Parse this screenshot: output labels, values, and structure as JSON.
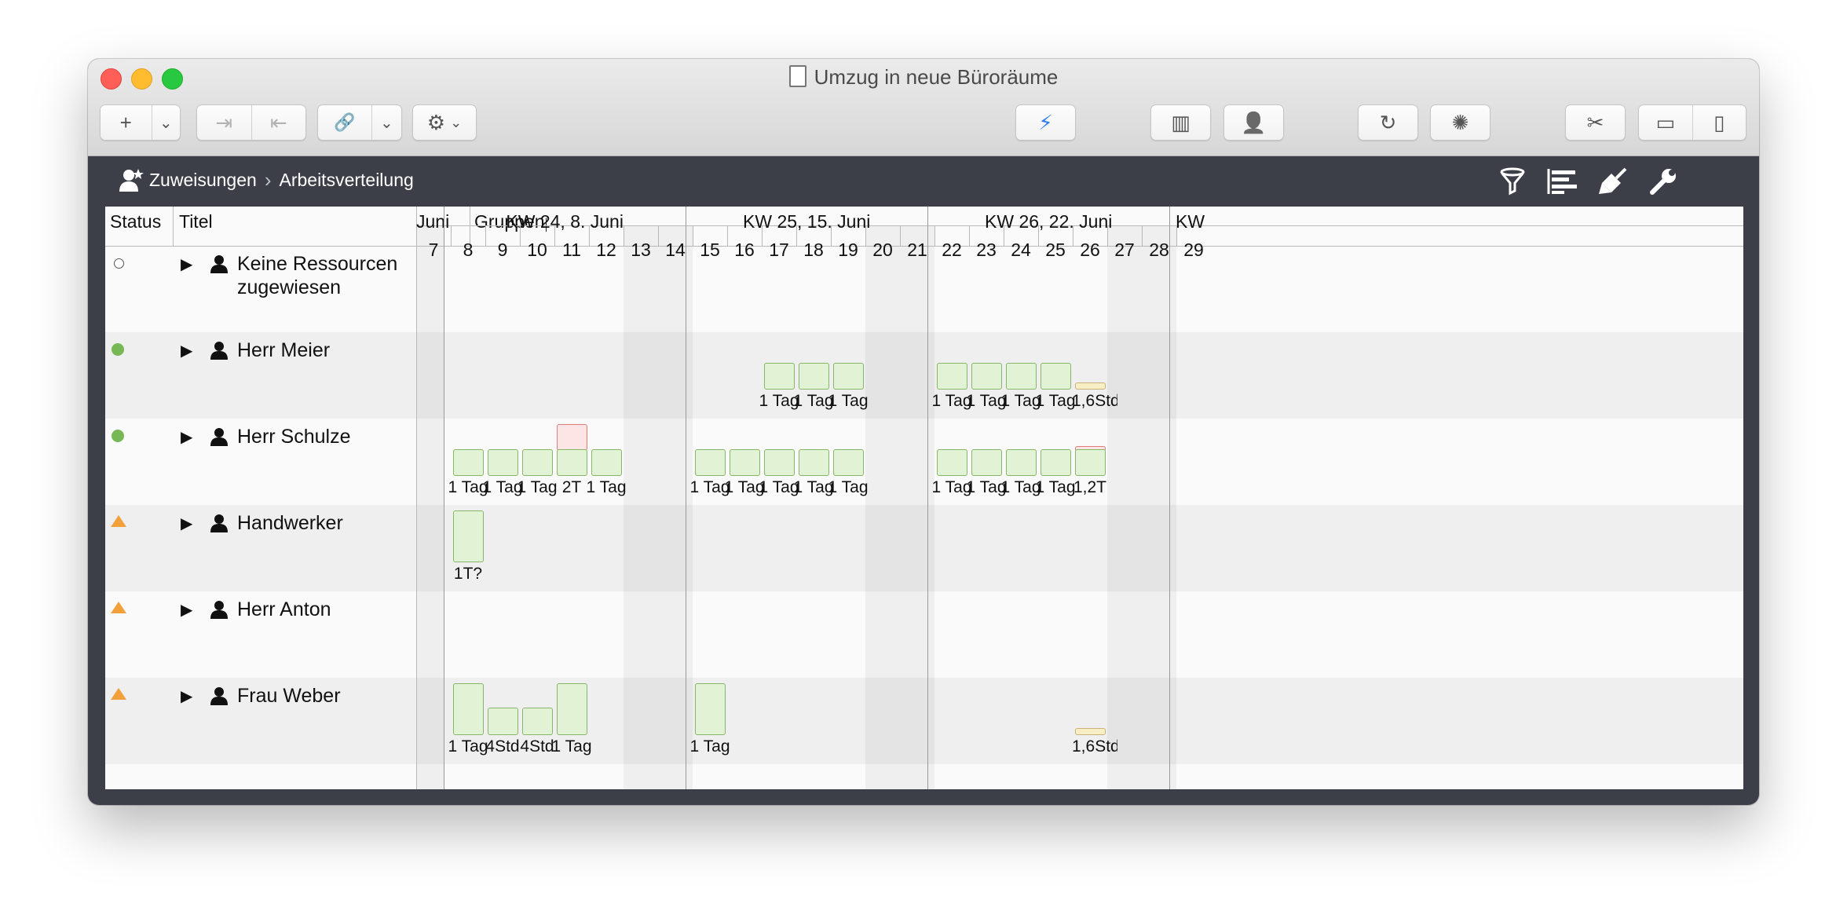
{
  "window": {
    "title": "Umzug in neue Büroräume"
  },
  "toolbar": {
    "add": "+",
    "dropdown": "⌄",
    "indent": "⇥",
    "outdent": "⇤",
    "link": "🔗",
    "gear": "⚙",
    "lightning": "⚡",
    "library": "▥",
    "person": "👤",
    "refresh": "↻",
    "network": "✺",
    "tools": "✂",
    "panel_bottom": "▭",
    "panel_right": "▯"
  },
  "breadcrumb": {
    "root": "Zuweisungen",
    "separator": "›",
    "current": "Arbeitsverteilung"
  },
  "columns": {
    "status": "Status",
    "title": "Titel",
    "group": "Gruppenpf"
  },
  "weeks": [
    {
      "label": "Juni"
    },
    {
      "label": "KW 24, 8. Juni"
    },
    {
      "label": "KW 25, 15. Juni"
    },
    {
      "label": "KW 26, 22. Juni"
    },
    {
      "label": "KW"
    }
  ],
  "days": [
    "7",
    "8",
    "9",
    "10",
    "11",
    "12",
    "13",
    "14",
    "15",
    "16",
    "17",
    "18",
    "19",
    "20",
    "21",
    "22",
    "23",
    "24",
    "25",
    "26",
    "27",
    "28",
    "29"
  ],
  "rows": [
    {
      "status": "open",
      "title_line1": "Keine Ressourcen",
      "title_line2": "zugewiesen",
      "bars": []
    },
    {
      "status": "ok",
      "title_line1": "Herr Meier",
      "title_line2": "",
      "bars": [
        {
          "day": "17",
          "label": "1 Tag",
          "kind": "normal"
        },
        {
          "day": "18",
          "label": "1 Tag",
          "kind": "normal"
        },
        {
          "day": "19",
          "label": "1 Tag",
          "kind": "normal"
        },
        {
          "day": "22",
          "label": "1 Tag",
          "kind": "normal"
        },
        {
          "day": "23",
          "label": "1 Tag",
          "kind": "normal"
        },
        {
          "day": "24",
          "label": "1 Tag",
          "kind": "normal"
        },
        {
          "day": "25",
          "label": "1 Tag",
          "kind": "normal"
        },
        {
          "day": "26",
          "label": "1,6Std",
          "kind": "small"
        }
      ]
    },
    {
      "status": "ok",
      "title_line1": "Herr Schulze",
      "title_line2": "",
      "bars": [
        {
          "day": "8",
          "label": "1 Tag",
          "kind": "normal"
        },
        {
          "day": "9",
          "label": "1 Tag",
          "kind": "normal"
        },
        {
          "day": "10",
          "label": "1 Tag",
          "kind": "normal"
        },
        {
          "day": "11",
          "label": "2T",
          "kind": "over"
        },
        {
          "day": "12",
          "label": "1 Tag",
          "kind": "normal"
        },
        {
          "day": "15",
          "label": "1 Tag",
          "kind": "normal"
        },
        {
          "day": "16",
          "label": "1 Tag",
          "kind": "normal"
        },
        {
          "day": "17",
          "label": "1 Tag",
          "kind": "normal"
        },
        {
          "day": "18",
          "label": "1 Tag",
          "kind": "normal"
        },
        {
          "day": "19",
          "label": "1 Tag",
          "kind": "normal"
        },
        {
          "day": "22",
          "label": "1 Tag",
          "kind": "normal"
        },
        {
          "day": "23",
          "label": "1 Tag",
          "kind": "normal"
        },
        {
          "day": "24",
          "label": "1 Tag",
          "kind": "normal"
        },
        {
          "day": "25",
          "label": "1 Tag",
          "kind": "normal"
        },
        {
          "day": "26",
          "label": "1,2T",
          "kind": "overlight"
        }
      ]
    },
    {
      "status": "warn",
      "title_line1": "Handwerker",
      "title_line2": "",
      "bars": [
        {
          "day": "8",
          "label": "1T?",
          "kind": "tall"
        }
      ]
    },
    {
      "status": "warn",
      "title_line1": "Herr Anton",
      "title_line2": "",
      "bars": []
    },
    {
      "status": "warn",
      "title_line1": "Frau Weber",
      "title_line2": "",
      "bars": [
        {
          "day": "8",
          "label": "1 Tag",
          "kind": "tall"
        },
        {
          "day": "9",
          "label": "4Std",
          "kind": "half"
        },
        {
          "day": "10",
          "label": "4Std",
          "kind": "half"
        },
        {
          "day": "11",
          "label": "1 Tag",
          "kind": "tall"
        },
        {
          "day": "15",
          "label": "1 Tag",
          "kind": "tall"
        },
        {
          "day": "26",
          "label": "1,6Std",
          "kind": "small"
        }
      ]
    }
  ],
  "colors": {
    "bar_fill": "#e2f2d5",
    "bar_border": "#86b766",
    "overload": "#fde5e5",
    "status_ok": "#76b856",
    "status_warn": "#f2a13a"
  }
}
